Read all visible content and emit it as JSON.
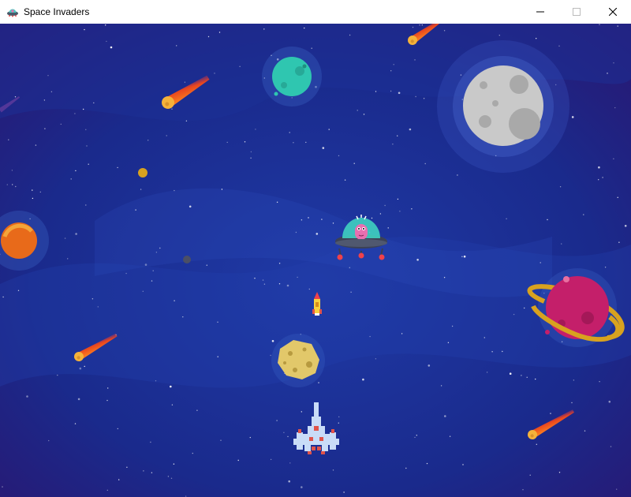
{
  "window": {
    "title": "Space Invaders",
    "icon": "alien-ufo-icon",
    "controls": [
      "minimize-icon",
      "maximize-icon",
      "close-icon"
    ]
  },
  "game": {
    "background_color": "#1b2a8c",
    "player": {
      "sprite": "pixel-spaceship",
      "color": "#c9dcf7",
      "accent": "#e0534a"
    },
    "enemy": {
      "sprite": "ufo-alien",
      "dome_color": "#3fd0c0",
      "alien_color": "#e86fb0"
    },
    "projectile": {
      "sprite": "missile",
      "color": "#f7d13d"
    },
    "obstacle": {
      "sprite": "asteroid",
      "color": "#e2c86a"
    },
    "decor": [
      "moon",
      "teal-planet",
      "orange-planet",
      "ringed-pink-planet",
      "comets"
    ]
  }
}
